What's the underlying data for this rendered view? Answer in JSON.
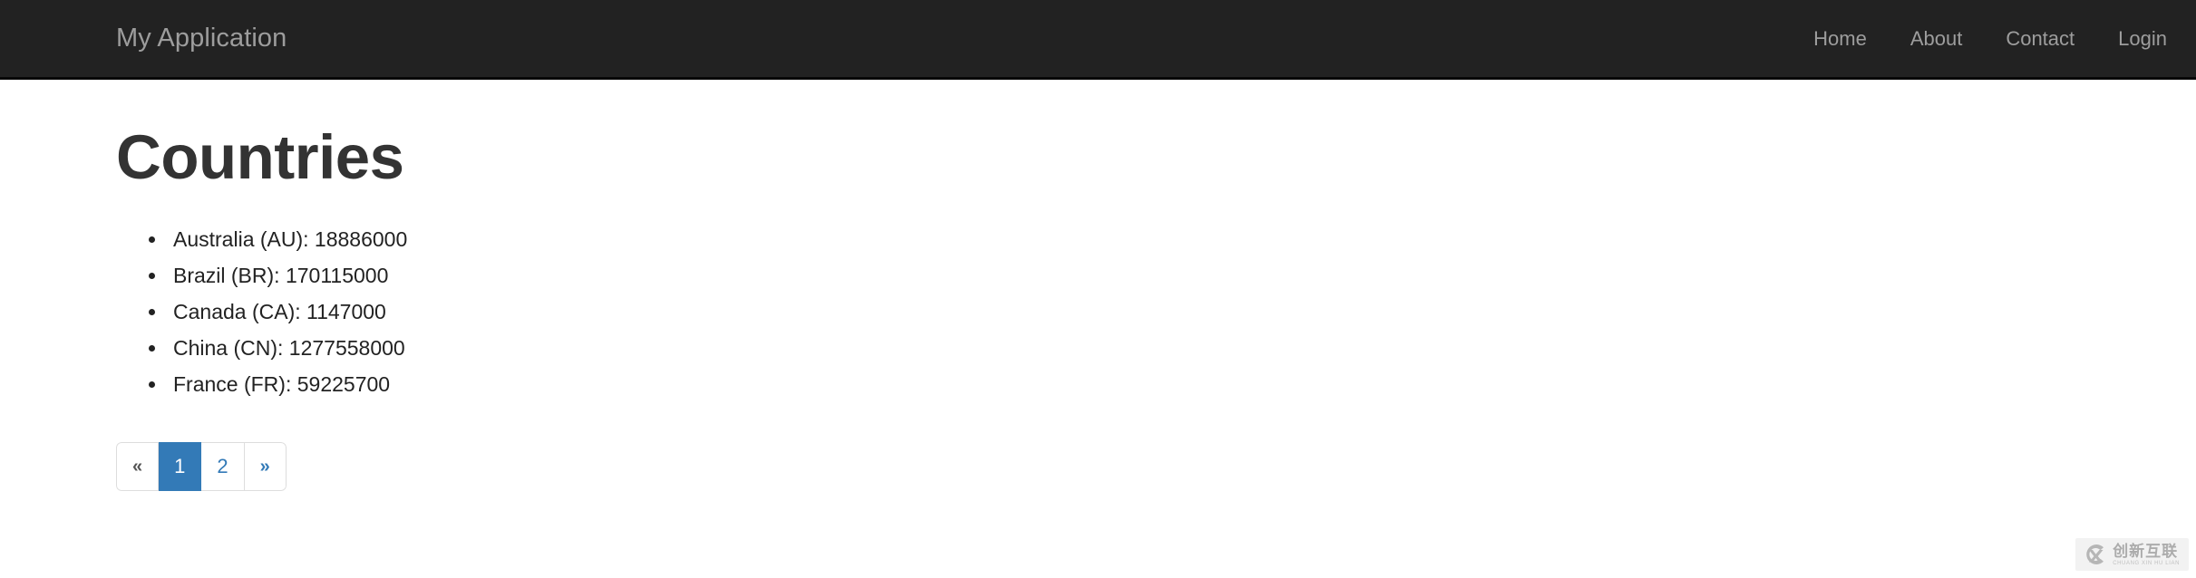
{
  "navbar": {
    "brand": "My Application",
    "brand_color": "#9d9d9d",
    "background_color": "#222222",
    "links": [
      {
        "label": "Home"
      },
      {
        "label": "About"
      },
      {
        "label": "Contact"
      },
      {
        "label": "Login"
      }
    ]
  },
  "main": {
    "title": "Countries",
    "countries": [
      {
        "text": "Australia (AU): 18886000",
        "name": "Australia",
        "code": "AU",
        "population": 18886000
      },
      {
        "text": "Brazil (BR): 170115000",
        "name": "Brazil",
        "code": "BR",
        "population": 170115000
      },
      {
        "text": "Canada (CA): 1147000",
        "name": "Canada",
        "code": "CA",
        "population": 1147000
      },
      {
        "text": "China (CN): 1277558000",
        "name": "China",
        "code": "CN",
        "population": 1277558000
      },
      {
        "text": "France (FR): 59225700",
        "name": "France",
        "code": "FR",
        "population": 59225700
      }
    ]
  },
  "pagination": {
    "active_color": "#337ab7",
    "link_color": "#337ab7",
    "current_page": 1,
    "items": [
      {
        "label": "«",
        "icon": "double-chevron-left-icon",
        "state": "muted"
      },
      {
        "label": "1",
        "state": "active"
      },
      {
        "label": "2",
        "state": "link"
      },
      {
        "label": "»",
        "icon": "double-chevron-right-icon",
        "state": "link"
      }
    ]
  },
  "watermark": {
    "cn": "创新互联",
    "pinyin": "CHUANG XIN HU LIAN"
  }
}
